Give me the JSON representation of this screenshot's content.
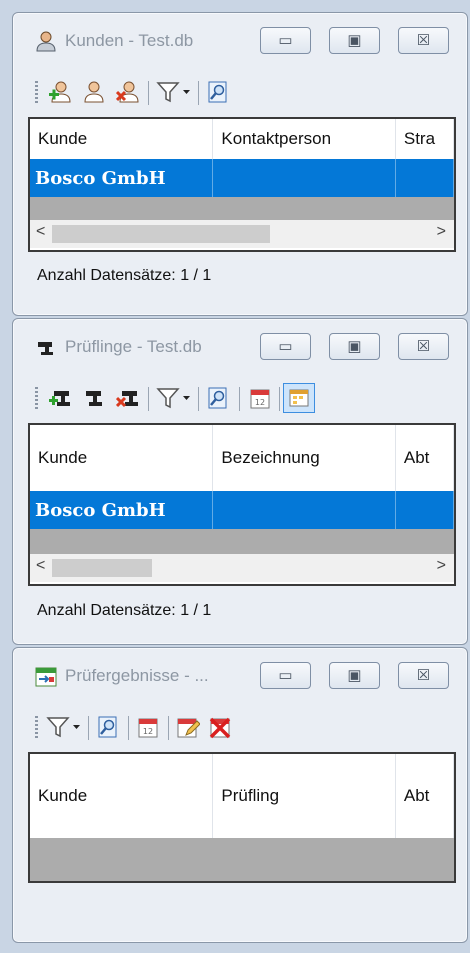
{
  "colors": {
    "selection": "#0478d7",
    "window_bg": "#eaeef4",
    "desktop": "#c9d5e4"
  },
  "windows": {
    "kunden": {
      "title": "Kunden - Test.db",
      "icon": "person-icon",
      "toolbar": [
        "add-person-icon",
        "person-icon",
        "delete-person-icon",
        "filter-icon",
        "search-document-icon"
      ],
      "columns": [
        "Kunde",
        "Kontaktperson",
        "Stra"
      ],
      "rows": [
        [
          "Bosco GmbH",
          "",
          ""
        ]
      ],
      "status": "Anzahl Datensätze: 1 / 1"
    },
    "pruflinge": {
      "title": "Prüflinge - Test.db",
      "icon": "plug-icon",
      "toolbar": [
        "add-plug-icon",
        "plug-icon",
        "delete-plug-icon",
        "filter-icon",
        "search-document-icon",
        "calendar-icon",
        "calendar-grid-icon"
      ],
      "columns": [
        "Kunde",
        "Bezeichnung",
        "Abt"
      ],
      "rows": [
        [
          "Bosco GmbH",
          "",
          ""
        ]
      ],
      "status": "Anzahl Datensätze: 1 / 1"
    },
    "prufergebnisse": {
      "title": "Prüfergebnisse - ...",
      "icon": "calendar-arrow-icon",
      "toolbar": [
        "filter-icon",
        "search-document-icon",
        "calendar-icon",
        "edit-calendar-icon",
        "delete-calendar-icon"
      ],
      "columns": [
        "Kunde",
        "Prüfling",
        "Abt"
      ]
    }
  },
  "window_buttons": {
    "minimize": "▭",
    "maximize": "▣",
    "close": "☒"
  },
  "scroll": {
    "left": "<",
    "right": ">"
  }
}
